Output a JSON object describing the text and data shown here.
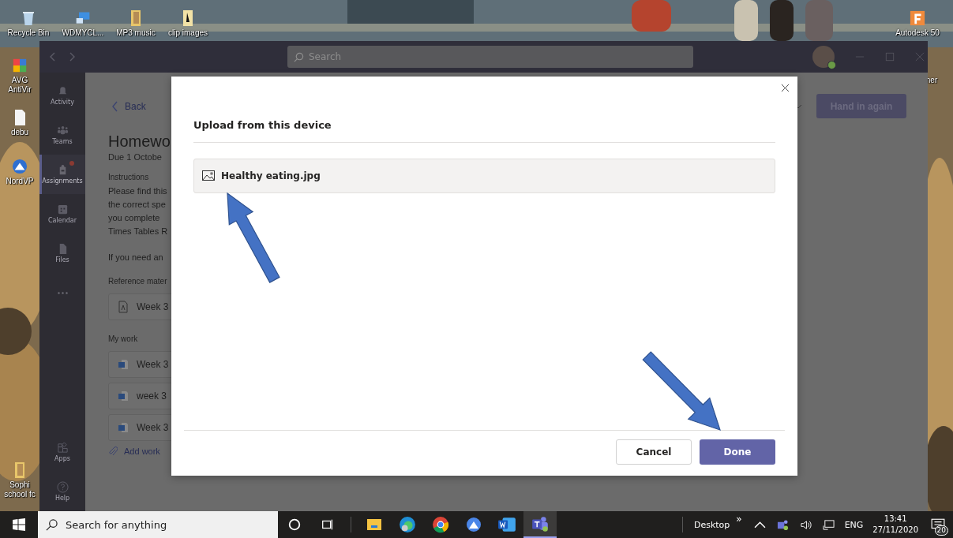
{
  "desktop_icons": [
    {
      "kind": "bin",
      "label": "Recycle Bin"
    },
    {
      "kind": "computer",
      "label": "WDMYCL..."
    },
    {
      "kind": "folder",
      "label": "MP3 music"
    },
    {
      "kind": "file",
      "label": "clip images"
    },
    {
      "kind": "shield",
      "label": "AVG AntiVir"
    },
    {
      "kind": "document",
      "label": "debu"
    },
    {
      "kind": "vpn",
      "label": "NordVP"
    },
    {
      "kind": "folder",
      "label": "Sophi school fc"
    },
    {
      "kind": "autodesk",
      "label": "Autodesk 50"
    },
    {
      "kind": "none",
      "label": "ner"
    }
  ],
  "teams": {
    "search": {
      "placeholder": "Search"
    },
    "rail": [
      {
        "label": "Activity",
        "kind": "bell",
        "selected": false,
        "badge": false
      },
      {
        "label": "Teams",
        "kind": "people",
        "selected": false,
        "badge": false
      },
      {
        "label": "Assignments",
        "kind": "bag",
        "selected": true,
        "badge": true
      },
      {
        "label": "Calendar",
        "kind": "calendar",
        "selected": false,
        "badge": false
      },
      {
        "label": "Files",
        "kind": "file",
        "selected": false,
        "badge": false
      },
      {
        "kind": "more",
        "selected": false,
        "badge": false
      }
    ],
    "rail_bottom": [
      {
        "label": "Apps",
        "kind": "apps",
        "selected": false,
        "badge": false
      },
      {
        "label": "Help",
        "kind": "help",
        "selected": false,
        "badge": false
      }
    ],
    "assignment": {
      "back": "Back",
      "hand_in": "Hand in again",
      "title": "Homewo",
      "due": "Due 1 Octobe",
      "instructions_label": "Instructions",
      "instructions": [
        "Please find this",
        "the correct spe",
        "you complete",
        "Times Tables R"
      ],
      "note": "If you need an",
      "reference_label": "Reference mater",
      "reference": [
        {
          "name": "Week 3",
          "kind": "pdf"
        }
      ],
      "my_work_label": "My work",
      "my_work": [
        {
          "name": "Week 3",
          "kind": "word"
        },
        {
          "name": "week 3",
          "kind": "word"
        },
        {
          "name": "Week 3",
          "kind": "word"
        }
      ],
      "add_work": "Add work"
    }
  },
  "dialog": {
    "title": "Upload from this device",
    "files": [
      {
        "name": "Healthy eating.jpg"
      }
    ],
    "cancel": "Cancel",
    "done": "Done"
  },
  "taskbar": {
    "search": {
      "placeholder": "Search for anything"
    },
    "apps": [
      {
        "kind": "cortana",
        "selected": false
      },
      {
        "kind": "taskview",
        "selected": false
      },
      {
        "kind": "explorer",
        "selected": false
      },
      {
        "kind": "edge",
        "selected": false
      },
      {
        "kind": "chrome",
        "selected": false
      },
      {
        "kind": "vpn",
        "selected": false
      },
      {
        "kind": "word",
        "selected": false
      },
      {
        "kind": "teams",
        "selected": true
      }
    ],
    "toolbar": "Desktop",
    "toolbar_more": "»",
    "language": "ENG",
    "time": "13:41",
    "date": "27/11/2020",
    "notifications": "20"
  }
}
